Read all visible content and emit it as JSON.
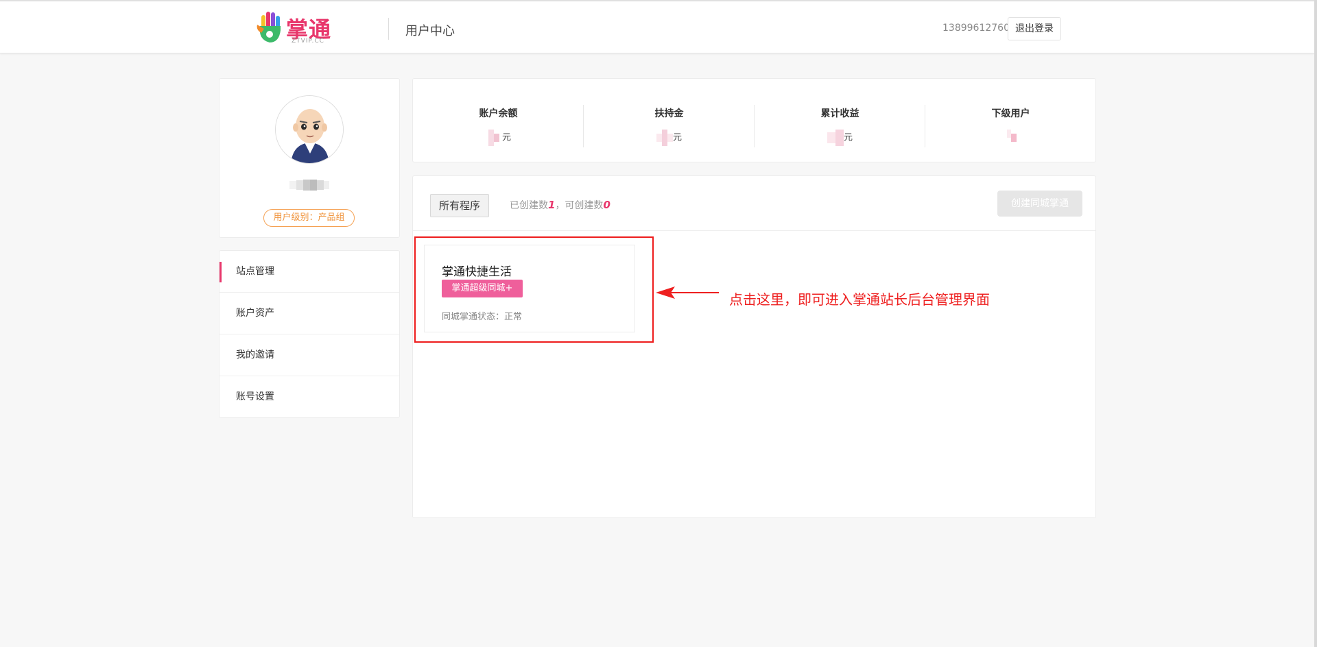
{
  "header": {
    "logo_text": "掌通",
    "logo_sub": "ZTVIP.CC",
    "title": "用户中心",
    "phone": "13899612760",
    "logout_label": "退出登录"
  },
  "profile": {
    "level_label": "用户级别：产品组"
  },
  "menu": {
    "items": [
      {
        "label": "站点管理"
      },
      {
        "label": "账户资产"
      },
      {
        "label": "我的邀请"
      },
      {
        "label": "账号设置"
      }
    ]
  },
  "stats": [
    {
      "label": "账户余额",
      "unit": "元"
    },
    {
      "label": "扶持金",
      "unit": "元"
    },
    {
      "label": "累计收益",
      "unit": "元"
    },
    {
      "label": "下级用户",
      "unit": ""
    }
  ],
  "programs": {
    "all_label": "所有程序",
    "created_prefix": "已创建数",
    "created_count": "1",
    "available_prefix": "，可创建数",
    "available_count": "0",
    "create_label": "创建同城掌通"
  },
  "site": {
    "name": "掌通快捷生活",
    "tag": "掌通超级同城+",
    "status": "同城掌通状态：正常"
  },
  "annotation": "点击这里，即可进入掌通站长后台管理界面",
  "colors": {
    "brand": "#e8366b",
    "tag": "#ef5f9b",
    "badge": "#f0953e",
    "annotation": "#ee2020"
  }
}
